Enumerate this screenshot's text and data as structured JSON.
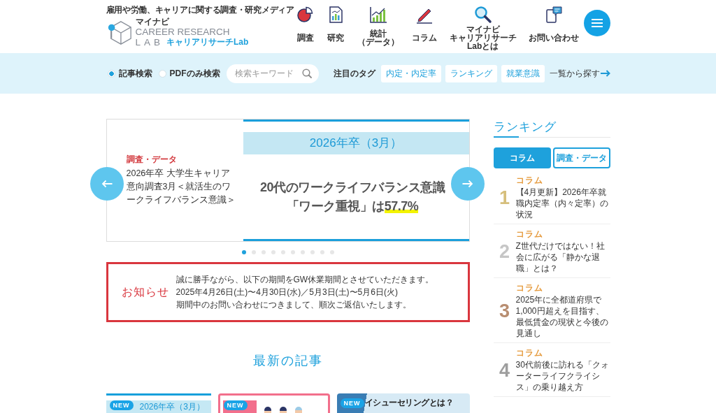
{
  "header": {
    "tagline": "雇用や労働、キャリアに関する調査・研究メディア",
    "logo": {
      "brand": "マイナビ",
      "line1": "CAREER RESEARCH",
      "line2": "LAB",
      "sub": "キャリアリサーチLab"
    },
    "nav": [
      {
        "label_lines": [
          "調査"
        ]
      },
      {
        "label_lines": [
          "研究"
        ]
      },
      {
        "label_lines": [
          "統計",
          "（データ）"
        ]
      },
      {
        "label_lines": [
          "コラム"
        ]
      },
      {
        "label_lines": [
          "マイナビ",
          "キャリアリサーチ",
          "Labとは"
        ]
      },
      {
        "label_lines": [
          "お問い合わせ"
        ]
      }
    ]
  },
  "search": {
    "options": [
      {
        "label": "記事検索",
        "selected": true
      },
      {
        "label": "PDFのみ検索",
        "selected": false
      }
    ],
    "placeholder": "検索キーワード",
    "tags_label": "注目のタグ",
    "tags": [
      "内定・内定率",
      "ランキング",
      "就業意識"
    ],
    "more_link": "一覧から探す"
  },
  "carousel": {
    "prev_slide": {
      "category": "調査・データ",
      "title": "2026年卒 大学生キャリア意向調査3月＜就活生のワークライフバランス意識＞"
    },
    "slide": {
      "band": "2026年卒（3月）",
      "headline_lines": [
        {
          "text": "20代のワークライフバランス意識"
        },
        {
          "text": "「ワーク重視」は",
          "highlight": "57.7%"
        }
      ]
    },
    "dots": [
      {
        "selected": true
      },
      {
        "selected": false
      },
      {
        "selected": false
      },
      {
        "selected": false
      },
      {
        "selected": false
      },
      {
        "selected": false
      },
      {
        "selected": false
      },
      {
        "selected": false
      },
      {
        "selected": false
      },
      {
        "selected": false
      }
    ]
  },
  "notice": {
    "label": "お知らせ",
    "lines": [
      "誠に勝手ながら、以下の期間をGW休業期間とさせていただきます。",
      "2025年4月26日(土)〜4月30日(水)／5月3日(土)〜5月6日(火)",
      "期間中のお問い合わせにつきまして、順次ご返信いたします。"
    ]
  },
  "latest": {
    "title": "最新の記事",
    "cards": [
      {
        "kind": "band",
        "badge": "NEW",
        "title": "2026年卒（3月）"
      },
      {
        "kind": "illustration",
        "badge": "NEW"
      },
      {
        "kind": "split",
        "badge": "NEW",
        "title": "イシューセリングとは？"
      }
    ]
  },
  "ranking": {
    "title": "ランキング",
    "tabs": [
      {
        "label": "コラム",
        "selected": true
      },
      {
        "label": "調査・データ",
        "selected": false
      }
    ],
    "items": [
      {
        "rank": "1",
        "color": "#d6bf7c",
        "category": "コラム",
        "title": "【4月更新】2026年卒就職内定率（内々定率）の状況"
      },
      {
        "rank": "2",
        "color": "#c6c6c6",
        "category": "コラム",
        "title": "Z世代だけではない！社会に広がる「静かな退職」とは？"
      },
      {
        "rank": "3",
        "color": "#b88d70",
        "category": "コラム",
        "title": "2025年に全都道府県で1,000円超えを目指す、最低賃金の現状と今後の見通し"
      },
      {
        "rank": "4",
        "color": "#9e9e9e",
        "category": "コラム",
        "title": "30代前後に訪れる「クォーターライフクライシス」の乗り越え方"
      }
    ]
  }
}
